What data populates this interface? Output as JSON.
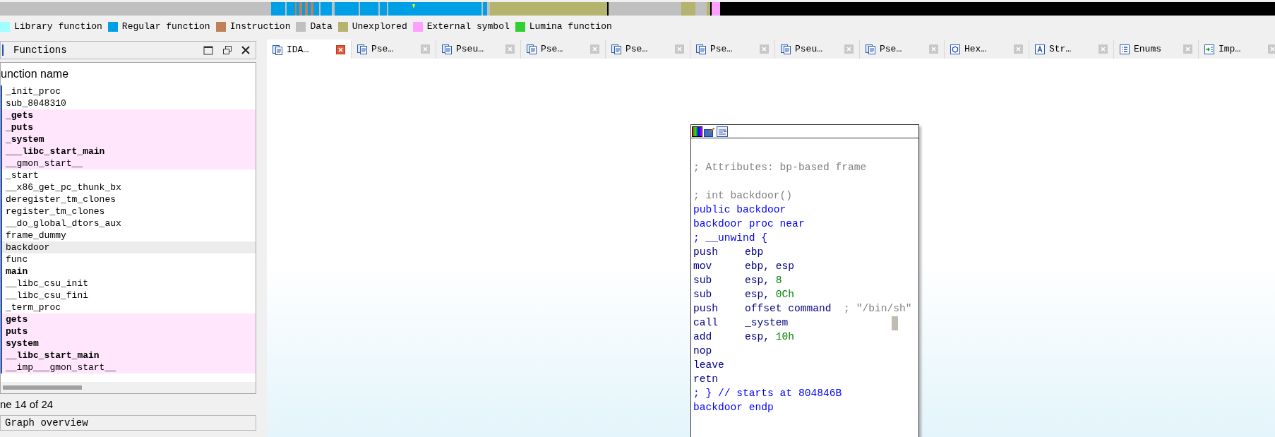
{
  "legend": [
    {
      "label": "Library function",
      "color": "#a0ffff"
    },
    {
      "label": "Regular function",
      "color": "#00a0e6"
    },
    {
      "label": "Instruction",
      "color": "#c0805a"
    },
    {
      "label": "Data",
      "color": "#c0c0c0"
    },
    {
      "label": "Unexplored",
      "color": "#b4b46e"
    },
    {
      "label": "External symbol",
      "color": "#ffa0ff"
    },
    {
      "label": "Lumina function",
      "color": "#30d030"
    }
  ],
  "functions_panel": {
    "title": "Functions",
    "column": "unction name",
    "status": "ne 14 of 24",
    "rows": [
      {
        "name": "_init_proc",
        "kind": "regular",
        "selected": false
      },
      {
        "name": "sub_8048310",
        "kind": "regular",
        "selected": false
      },
      {
        "name": "_gets",
        "kind": "imported",
        "selected": false
      },
      {
        "name": "_puts",
        "kind": "imported",
        "selected": false
      },
      {
        "name": "_system",
        "kind": "imported",
        "selected": false
      },
      {
        "name": "___libc_start_main",
        "kind": "imported",
        "selected": false
      },
      {
        "name": "__gmon_start__",
        "kind": "imported_plain",
        "selected": false
      },
      {
        "name": "_start",
        "kind": "regular",
        "selected": false
      },
      {
        "name": "__x86_get_pc_thunk_bx",
        "kind": "regular",
        "selected": false
      },
      {
        "name": "deregister_tm_clones",
        "kind": "regular",
        "selected": false
      },
      {
        "name": "register_tm_clones",
        "kind": "regular",
        "selected": false
      },
      {
        "name": "__do_global_dtors_aux",
        "kind": "regular",
        "selected": false
      },
      {
        "name": "frame_dummy",
        "kind": "regular",
        "selected": false
      },
      {
        "name": "backdoor",
        "kind": "regular",
        "selected": true
      },
      {
        "name": "func",
        "kind": "regular",
        "selected": false
      },
      {
        "name": "main",
        "kind": "entry",
        "selected": false
      },
      {
        "name": "__libc_csu_init",
        "kind": "regular",
        "selected": false
      },
      {
        "name": "__libc_csu_fini",
        "kind": "regular",
        "selected": false
      },
      {
        "name": "_term_proc",
        "kind": "regular",
        "selected": false
      },
      {
        "name": "gets",
        "kind": "imported",
        "selected": false
      },
      {
        "name": "puts",
        "kind": "imported",
        "selected": false
      },
      {
        "name": "system",
        "kind": "imported",
        "selected": false
      },
      {
        "name": "__libc_start_main",
        "kind": "imported",
        "selected": false
      },
      {
        "name": "__imp___gmon_start__",
        "kind": "imported_plain",
        "selected": false
      }
    ]
  },
  "graph_overview": {
    "title": "Graph overview"
  },
  "tabs": [
    {
      "label": "IDA…",
      "kind": "ida",
      "selected": true
    },
    {
      "label": "Pse…",
      "kind": "pseudo",
      "selected": false
    },
    {
      "label": "Pseu…",
      "kind": "pseudo",
      "selected": false
    },
    {
      "label": "Pse…",
      "kind": "pseudo",
      "selected": false
    },
    {
      "label": "Pse…",
      "kind": "pseudo",
      "selected": false
    },
    {
      "label": "Pse…",
      "kind": "pseudo",
      "selected": false
    },
    {
      "label": "Pseu…",
      "kind": "pseudo",
      "selected": false
    },
    {
      "label": "Pse…",
      "kind": "pseudo",
      "selected": false
    },
    {
      "label": "Hex…",
      "kind": "hex",
      "selected": false
    },
    {
      "label": "Str…",
      "kind": "strings",
      "selected": false
    },
    {
      "label": "Enums",
      "kind": "enums",
      "selected": false
    },
    {
      "label": "Imp…",
      "kind": "imports",
      "selected": false
    }
  ],
  "graph_node": {
    "lines": [
      {
        "kind": "blank"
      },
      {
        "parts": [
          {
            "text": "; Attributes: bp-based frame",
            "kind": "comment"
          }
        ]
      },
      {
        "kind": "blank"
      },
      {
        "parts": [
          {
            "text": "; int backdoor()",
            "kind": "comment"
          }
        ]
      },
      {
        "parts": [
          {
            "text": "public backdoor",
            "kind": "directive"
          }
        ]
      },
      {
        "parts": [
          {
            "text": "backdoor proc near",
            "kind": "directive"
          }
        ]
      },
      {
        "parts": [
          {
            "text": "; __unwind {",
            "kind": "directive"
          }
        ]
      },
      {
        "parts": [
          {
            "text": "push",
            "kind": "mnemonic"
          },
          {
            "text": "ebp",
            "kind": "operand"
          }
        ]
      },
      {
        "parts": [
          {
            "text": "mov",
            "kind": "mnemonic"
          },
          {
            "text": "ebp, esp",
            "kind": "operand"
          }
        ]
      },
      {
        "parts": [
          {
            "text": "sub",
            "kind": "mnemonic"
          },
          {
            "text": "esp, ",
            "kind": "operand"
          },
          {
            "text": "8",
            "kind": "number"
          }
        ]
      },
      {
        "parts": [
          {
            "text": "sub",
            "kind": "mnemonic"
          },
          {
            "text": "esp, ",
            "kind": "operand"
          },
          {
            "text": "0Ch",
            "kind": "number"
          }
        ]
      },
      {
        "parts": [
          {
            "text": "push",
            "kind": "mnemonic"
          },
          {
            "text": "offset command",
            "kind": "operand"
          },
          {
            "text": "  ; \"/bin/sh\"",
            "kind": "comment"
          }
        ]
      },
      {
        "parts": [
          {
            "text": "call",
            "kind": "mnemonic"
          },
          {
            "text": "_system",
            "kind": "operand"
          }
        ],
        "cursor": true
      },
      {
        "parts": [
          {
            "text": "add",
            "kind": "mnemonic"
          },
          {
            "text": "esp, ",
            "kind": "operand"
          },
          {
            "text": "10h",
            "kind": "number"
          }
        ]
      },
      {
        "parts": [
          {
            "text": "nop",
            "kind": "mnemonic"
          }
        ]
      },
      {
        "parts": [
          {
            "text": "leave",
            "kind": "mnemonic"
          }
        ]
      },
      {
        "parts": [
          {
            "text": "retn",
            "kind": "mnemonic"
          }
        ]
      },
      {
        "parts": [
          {
            "text": "; } // starts at 804846B",
            "kind": "directive"
          }
        ]
      },
      {
        "parts": [
          {
            "text": "backdoor endp",
            "kind": "directive"
          }
        ]
      }
    ]
  }
}
